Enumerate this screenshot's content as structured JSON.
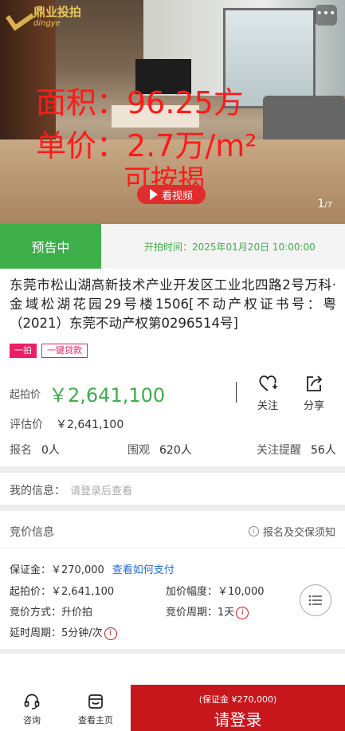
{
  "hero": {
    "logo_cn": "鼎业投拍",
    "logo_en": "dingye",
    "overlay_area": "面积：96.25方",
    "overlay_price": "单价：2.7万/m²",
    "overlay_loan": "可按揭",
    "video_label": "看视频",
    "pager_current": "1",
    "pager_total": "/7",
    "more": "•••"
  },
  "status": {
    "tag": "预告中",
    "start_time": "开拍时间：2025年01月20日 10:00:00"
  },
  "title": "东莞市松山湖高新技术产业开发区工业北四路2号万科·金域松湖花园29号楼1506[不动产权证书号：粤（2021）东莞不动产权第0296514号]",
  "badges": [
    "一拍",
    "一键贷款"
  ],
  "price": {
    "label": "起拍价",
    "value": "￥2,641,100",
    "estimate_label": "评估价",
    "estimate_value": "￥2,641,100"
  },
  "actions": {
    "follow": "关注",
    "share": "分享"
  },
  "stats": {
    "signup_label": "报名",
    "signup_value": "0人",
    "watch_label": "围观",
    "watch_value": "620人",
    "remind_label": "关注提醒",
    "remind_value": "56人"
  },
  "my_info": {
    "label": "我的信息：",
    "hint": "请登录后查看"
  },
  "bidding": {
    "header": "竞价信息",
    "notice": "报名及交保须知",
    "deposit_label": "保证金：",
    "deposit_value": "￥270,000",
    "pay_link": "查看如何支付",
    "start_label": "起拍价：",
    "start_value": "￥2,641,100",
    "increment_label": "加价幅度：",
    "increment_value": "￥10,000",
    "method_label": "竞价方式：",
    "method_value": "升价拍",
    "cycle_label": "竞价周期：",
    "cycle_value": "1天",
    "delay_label": "延时周期：",
    "delay_value": "5分钟/次"
  },
  "bottom": {
    "consult": "咨询",
    "home": "查看主页",
    "login_sub": "(保证金 ¥270,000)",
    "login_main": "请登录"
  },
  "colors": {
    "green": "#3dae4a",
    "red": "#c8161d",
    "pink": "#e91e63",
    "link": "#1e6bd6"
  }
}
